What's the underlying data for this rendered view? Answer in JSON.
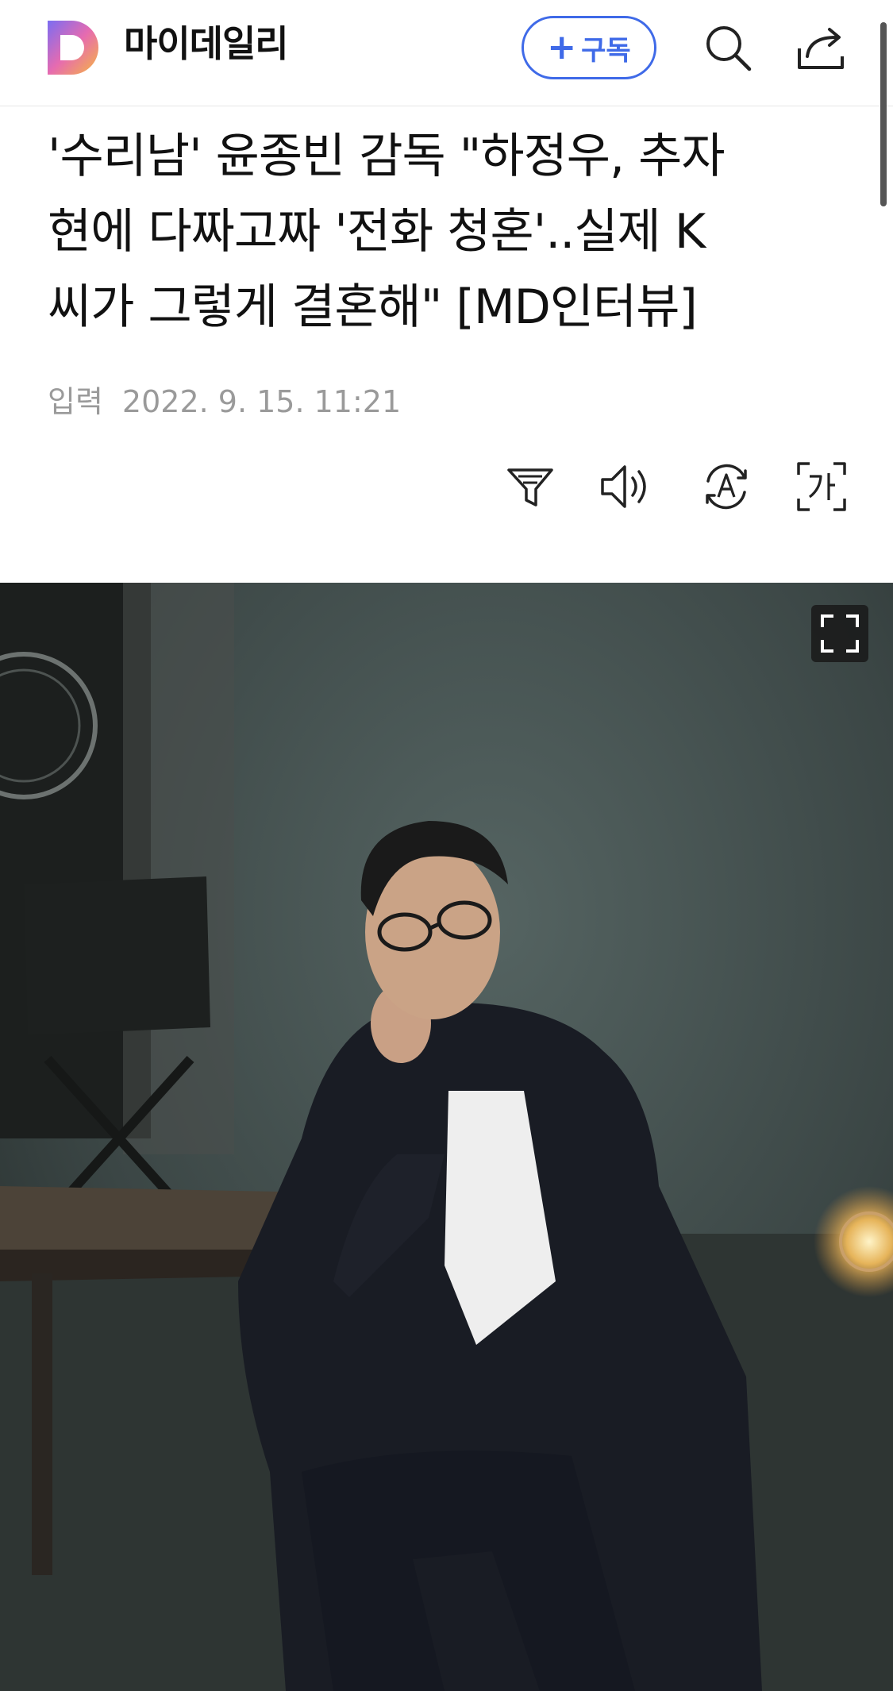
{
  "header": {
    "logo_icon": "daum-d-logo-icon",
    "brand_name": "마이데일리",
    "subscribe_plus": "+",
    "subscribe_label": "구독",
    "accent_color": "#3f6ae8",
    "search_icon": "search-icon",
    "share_icon": "share-icon"
  },
  "article": {
    "title": "'수리남' 윤종빈 감독 \"하정우, 추자\n현에 다짜고짜 '전화 청혼'..실제 K\n씨가 그렇게 결혼해\" [MD인터뷰]",
    "date_label": "입력",
    "date_value": "2022. 9. 15. 11:21"
  },
  "tools": [
    {
      "name": "summary-filter-icon"
    },
    {
      "name": "read-aloud-speaker-icon"
    },
    {
      "name": "translate-icon"
    },
    {
      "name": "font-size-icon"
    }
  ],
  "photo": {
    "fullscreen_icon": "fullscreen-expand-icon"
  }
}
